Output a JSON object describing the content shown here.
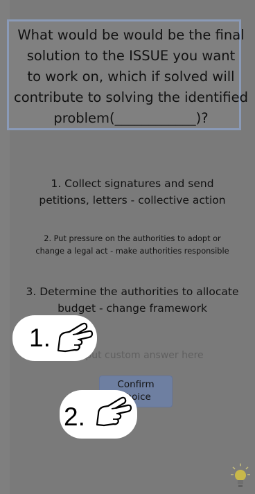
{
  "question": {
    "lines": [
      "What would be would be the final",
      "solution to the ISSUE you want",
      "to work on, which if solved will",
      "contribute to solving the identified",
      "problem(____________)?"
    ]
  },
  "options": [
    {
      "lines": [
        "1. Collect signatures and send",
        "petitions, letters - collective action"
      ]
    },
    {
      "lines": [
        "2. Put pressure on the authorities to adopt or",
        "change a legal act - make authorities responsible"
      ]
    },
    {
      "lines": [
        "3. Determine the authorities to allocate",
        "budget - change framework"
      ]
    }
  ],
  "custom_answer": {
    "placeholder": "Input custom answer here",
    "value": ""
  },
  "confirm_button": {
    "lines": [
      "Confirm",
      "choice"
    ]
  },
  "hints": [
    {
      "number": "1.",
      "icon": "pointing-hand-icon"
    },
    {
      "number": "2.",
      "icon": "pointing-hand-icon"
    }
  ],
  "footer_icon": "lightbulb-icon",
  "colors": {
    "overlay": "#7a7a7a",
    "box_border": "#8a9ab7",
    "button": "#6e7fa1"
  }
}
